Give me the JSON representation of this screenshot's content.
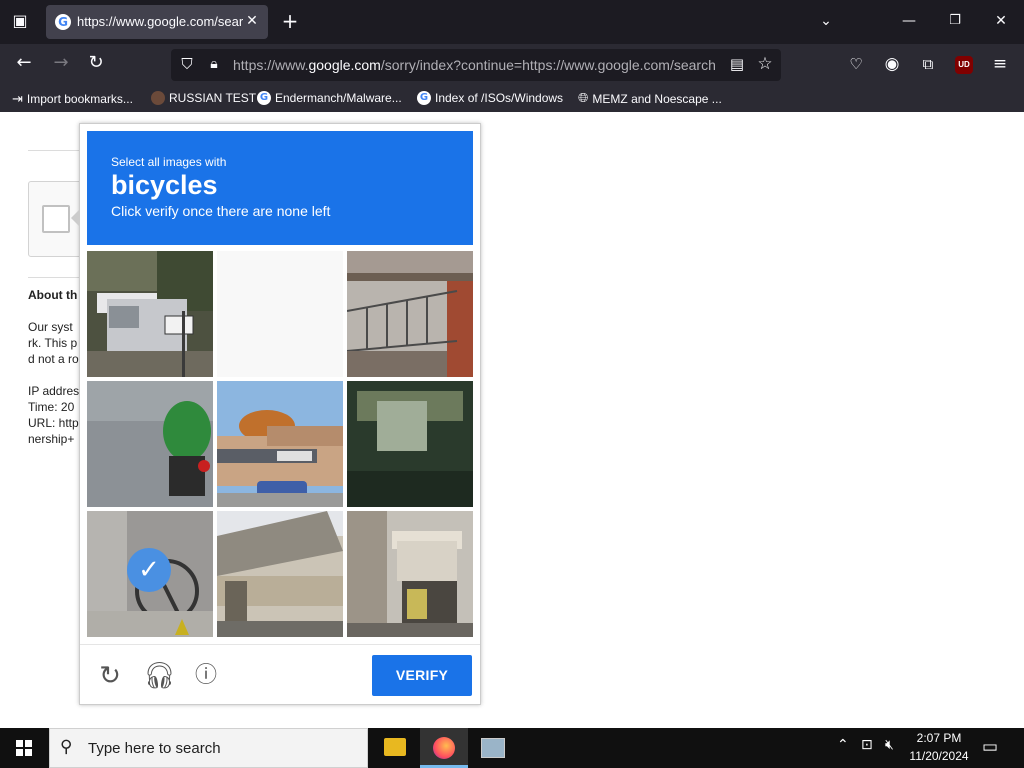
{
  "browser": {
    "tab_title": "https://www.google.com/search",
    "url_prefix": "https://www.",
    "url_domain": "google.com",
    "url_rest": "/sorry/index?continue=https://www.google.com/search",
    "bookmarks": [
      {
        "label": "Import bookmarks...",
        "icon": "import-icon"
      },
      {
        "label": "RUSSIAN TEST",
        "icon": "avatar-icon"
      },
      {
        "label": "Endermanch/Malware...",
        "icon": "google-icon"
      },
      {
        "label": "Index of /ISOs/Windows",
        "icon": "google-icon"
      },
      {
        "label": "MEMZ and Noescape ...",
        "icon": "globe-icon"
      }
    ],
    "extension_badge": "UD"
  },
  "page": {
    "about_heading": "About th",
    "para_lines": [
      "Our syst",
      "rk. This p",
      "d not a ro"
    ],
    "info_lines": [
      "IP addres",
      "Time: 20",
      "URL: http",
      "nership+"
    ]
  },
  "challenge": {
    "instruction_small": "Select all images with",
    "target_word": "bicycles",
    "instruction_sub": "Click verify once there are none left",
    "verify_label": "VERIFY",
    "tiles": [
      {
        "description": "truck",
        "selected": false
      },
      {
        "description": "blank-loading",
        "selected": false
      },
      {
        "description": "balcony",
        "selected": false
      },
      {
        "description": "motorcycle-rider",
        "selected": false
      },
      {
        "description": "storefront-street",
        "selected": false
      },
      {
        "description": "dark-window",
        "selected": false
      },
      {
        "description": "bicycle",
        "selected": true
      },
      {
        "description": "building-overhang",
        "selected": false
      },
      {
        "description": "shop-front",
        "selected": false
      }
    ],
    "header_color": "#1a73e8"
  },
  "taskbar": {
    "search_placeholder": "Type here to search",
    "time": "2:07 PM",
    "date": "11/20/2024"
  }
}
